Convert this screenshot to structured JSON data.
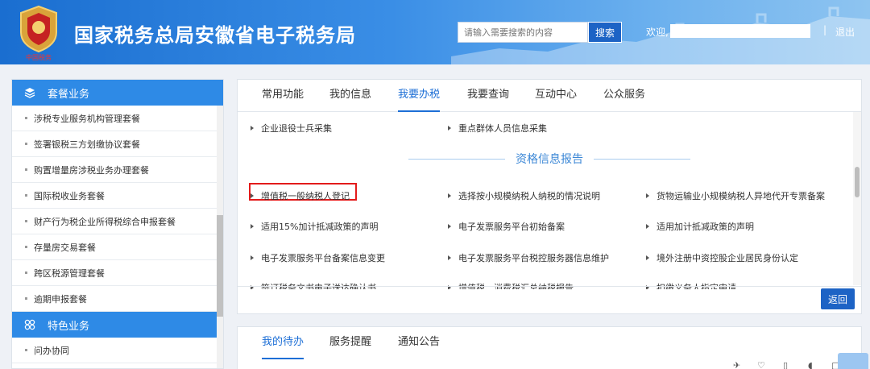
{
  "header": {
    "site_title": "国家税务总局安徽省电子税务局",
    "search_placeholder": "请输入需要搜索的内容",
    "search_button": "搜索",
    "welcome_label": "欢迎,",
    "separator": "|",
    "logout_label": "退出"
  },
  "sidebar": {
    "section1_title": "套餐业务",
    "items": [
      {
        "label": "涉税专业服务机构管理套餐"
      },
      {
        "label": "签署银税三方划缴协议套餐"
      },
      {
        "label": "购置增量房涉税业务办理套餐"
      },
      {
        "label": "国际税收业务套餐"
      },
      {
        "label": "财产行为税企业所得税综合申报套餐"
      },
      {
        "label": "存量房交易套餐"
      },
      {
        "label": "跨区税源管理套餐"
      },
      {
        "label": "逾期申报套餐"
      }
    ],
    "section2_title": "特色业务",
    "items2": [
      {
        "label": "问办协同"
      }
    ]
  },
  "main": {
    "tabs": [
      {
        "label": "常用功能"
      },
      {
        "label": "我的信息"
      },
      {
        "label": "我要办税"
      },
      {
        "label": "我要查询"
      },
      {
        "label": "互动中心"
      },
      {
        "label": "公众服务"
      }
    ],
    "active_tab": "我要办税",
    "top_links": [
      {
        "label": "企业退役士兵采集"
      },
      {
        "label": "重点群体人员信息采集"
      }
    ],
    "section_title": "资格信息报告",
    "grid_links": [
      {
        "label": "增值税一般纳税人登记"
      },
      {
        "label": "选择按小规模纳税人纳税的情况说明"
      },
      {
        "label": "货物运输业小规模纳税人异地代开专票备案"
      },
      {
        "label": "适用15%加计抵减政策的声明"
      },
      {
        "label": "电子发票服务平台初始备案"
      },
      {
        "label": "适用加计抵减政策的声明"
      },
      {
        "label": "电子发票服务平台备案信息变更"
      },
      {
        "label": "电子发票服务平台税控服务器信息维护"
      },
      {
        "label": "境外注册中资控股企业居民身份认定"
      },
      {
        "label": "签订税务文书电子送达确认书"
      },
      {
        "label": "增值税、消费税汇总纳税报告"
      },
      {
        "label": "扣缴义务人指定申请"
      }
    ],
    "back_button": "返回"
  },
  "panel2": {
    "tabs": [
      {
        "label": "我的待办"
      },
      {
        "label": "服务提醒"
      },
      {
        "label": "通知公告"
      }
    ],
    "active_tab": "我的待办"
  },
  "colors": {
    "header_blue": "#1a6ed0",
    "sidebar_head": "#2e8ae6",
    "accent": "#1d6fd6",
    "highlight_red": "#e31b1b"
  }
}
